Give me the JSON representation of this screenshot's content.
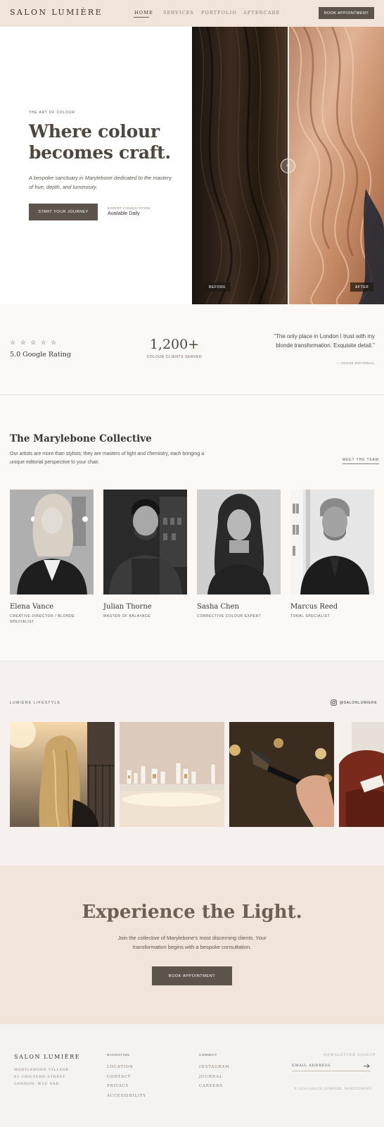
{
  "header": {
    "logo": "SALON LUMIÈRE",
    "nav": [
      "HOME",
      "SERVICES",
      "PORTFOLIO",
      "AFTERCARE"
    ],
    "active_nav": "HOME",
    "book_label": "BOOK APPOINTMENT"
  },
  "hero": {
    "eyebrow": "THE ART OF COLOUR",
    "title": "Where colour becomes craft.",
    "subtitle": "A bespoke sanctuary in Marylebone dedicated to the mastery of hue, depth, and luminosity.",
    "cta_label": "START YOUR JOURNEY",
    "consult_label": "EXPERT CONSULTATION",
    "consult_value": "Available Daily",
    "before_label": "BEFORE",
    "after_label": "AFTER"
  },
  "stats": {
    "stars": "☆ ☆ ☆ ☆ ☆",
    "rating": "5.0 Google Rating",
    "clients": "1,200+",
    "clients_label": "COLOUR CLIENTS SERVED",
    "quote": "\"The only place in London I trust with my blonde transformation. Exquisite detail.\"",
    "quote_source": "— VOGUE EDITORIAL"
  },
  "team": {
    "title": "The Marylebone Collective",
    "description": "Our artists are more than stylists; they are masters of light and chemistry, each bringing a unique editorial perspective to your chair.",
    "link_label": "MEET THE TEAM",
    "members": [
      {
        "name": "Elena Vance",
        "role": "CREATIVE DIRECTOR / BLONDE SPECIALIST"
      },
      {
        "name": "Julian Thorne",
        "role": "MASTER OF BALAYAGE"
      },
      {
        "name": "Sasha Chen",
        "role": "CORRECTIVE COLOUR EXPERT"
      },
      {
        "name": "Marcus Reed",
        "role": "TONAL SPECIALIST"
      }
    ]
  },
  "lifestyle": {
    "label": "LUMIÈRE LIFESTYLE",
    "instagram_handle": "@SALONLUMIERE"
  },
  "cta": {
    "title": "Experience the Light.",
    "text": "Join the collective of Marylebone's most discerning clients. Your transformation begins with a bespoke consultation.",
    "button_label": "BOOK APPOINTMENT"
  },
  "footer": {
    "logo": "SALON LUMIÈRE",
    "address": [
      "MARYLEBONE VILLAGE",
      "62 CHILTERN STREET",
      "LONDON, W1U 4AD"
    ],
    "navigation_title": "NAVIGATION",
    "navigation_links": [
      "LOCATION",
      "CONTACT",
      "PRIVACY",
      "ACCESSIBILITY"
    ],
    "connect_title": "CONNECT",
    "connect_links": [
      "INSTAGRAM",
      "JOURNAL",
      "CAREERS"
    ],
    "newsletter_title": "NEWSLETTER SIGNUP",
    "email_placeholder": "EMAIL ADDRESS",
    "copyright": "© 2024 SALON LUMIÈRE. MARYLEBONE."
  },
  "colors": {
    "header_bg": "#f1e4da",
    "button_bg": "#5d554c",
    "accent_text": "#4f463d",
    "cta_title": "#6e5f54"
  }
}
